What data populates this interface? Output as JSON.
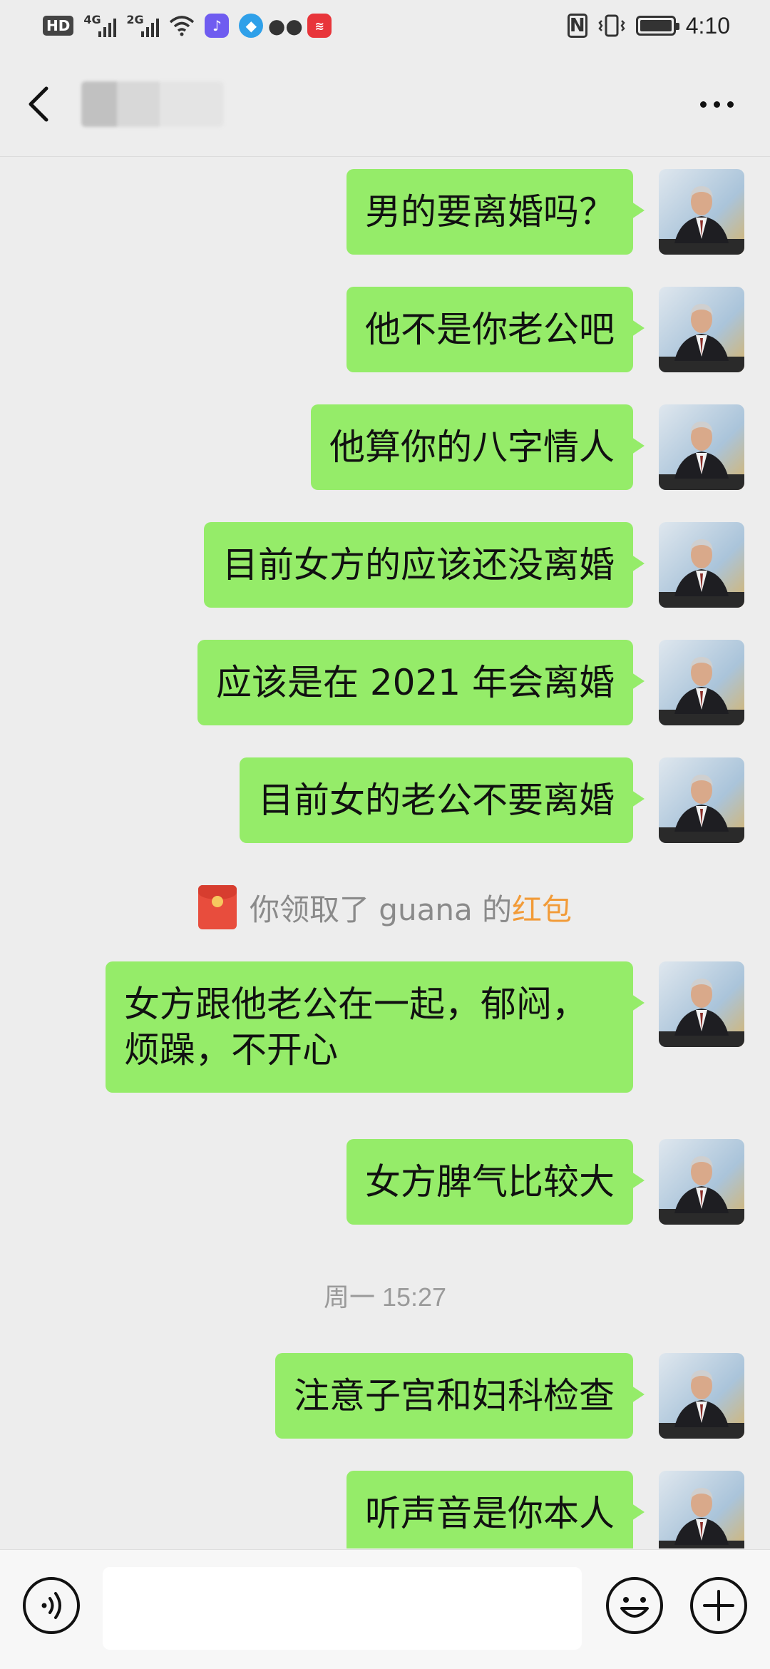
{
  "status_bar": {
    "hd_label": "HD",
    "net1": "4G",
    "net2": "2G",
    "nfc_label": "N",
    "time": "4:10",
    "icons": [
      "signal-icon",
      "wifi-icon",
      "music-app-icon",
      "browser-app-icon",
      "wechat-icon",
      "notification-app-icon",
      "nfc-icon",
      "vibrate-icon",
      "battery-icon"
    ]
  },
  "header": {
    "back_icon": "chevron-left-icon",
    "more_icon": "more-dots-icon"
  },
  "messages": [
    {
      "text": "男的要离婚吗？"
    },
    {
      "text": "他不是你老公吧"
    },
    {
      "text": "他算你的八字情人"
    },
    {
      "text": "目前女方的应该还没离婚"
    },
    {
      "text": "应该是在 2021 年会离婚"
    },
    {
      "text": "目前女的老公不要离婚"
    },
    {
      "text": "女方跟他老公在一起，郁闷，烦躁，不开心"
    },
    {
      "text": "女方脾气比较大"
    },
    {
      "text": "注意子宫和妇科检查"
    },
    {
      "text": "听声音是你本人"
    }
  ],
  "system_note": {
    "prefix": "你领取了 guana 的",
    "highlight": "红包",
    "highlight_color": "#f29b38"
  },
  "timestamp": "周一 15:27",
  "colors": {
    "bubble": "#95ec69",
    "background": "#ededed"
  },
  "input_bar": {
    "voice_icon": "voice-icon",
    "emoji_icon": "emoji-icon",
    "plus_icon": "plus-icon",
    "placeholder": ""
  }
}
